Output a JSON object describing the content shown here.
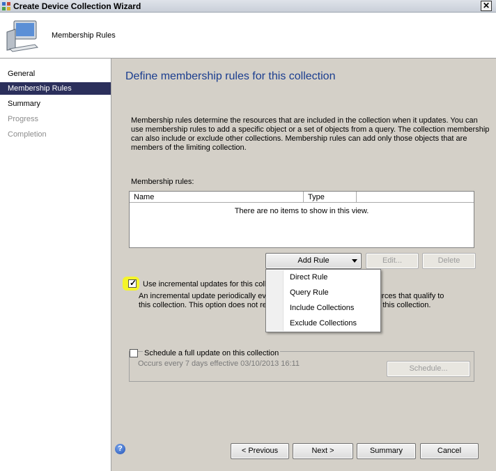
{
  "window": {
    "title": "Create Device Collection Wizard",
    "close_glyph": "✕"
  },
  "header": {
    "title": "Membership Rules",
    "icon": "computer-icon"
  },
  "sidebar": {
    "items": [
      {
        "label": "General",
        "state": "normal"
      },
      {
        "label": "Membership Rules",
        "state": "active"
      },
      {
        "label": "Summary",
        "state": "normal"
      },
      {
        "label": "Progress",
        "state": "disabled"
      },
      {
        "label": "Completion",
        "state": "disabled"
      }
    ]
  },
  "main": {
    "page_title": "Define membership rules for this collection",
    "description": "Membership rules determine the resources that are included in the collection when it updates. You can use membership rules to add a specific object or a set of objects from a query. The collection membership can also include or exclude other collections. Membership rules can add only those objects that are members of the limiting collection.",
    "rules_label": "Membership rules:",
    "list": {
      "columns": [
        "Name",
        "Type"
      ],
      "empty_text": "There are no items to show in this view."
    },
    "buttons": {
      "add_rule": "Add Rule",
      "edit": "Edit...",
      "delete": "Delete"
    },
    "incremental": {
      "checked": true,
      "label": "Use incremental updates for this colle",
      "desc_part1": "An incremental update periodically eva",
      "desc_part2": "s resources that qualify to",
      "desc_part3": "this collection. This option does not rec",
      "desc_part4": "or this collection."
    },
    "schedule": {
      "checked": false,
      "label": "Schedule a full update on this collection",
      "occurs": "Occurs every 7 days effective 03/10/2013 16:11",
      "button": "Schedule..."
    }
  },
  "dropdown_menu": {
    "items": [
      "Direct Rule",
      "Query Rule",
      "Include Collections",
      "Exclude Collections"
    ],
    "highlighted": "Query Rule"
  },
  "footer": {
    "help_glyph": "?",
    "previous": "< Previous",
    "next": "Next >",
    "summary": "Summary",
    "cancel": "Cancel"
  },
  "colors": {
    "nav_active": "#2b2f5b",
    "title_blue": "#1a3d8f",
    "highlight": "#f5f52a"
  }
}
